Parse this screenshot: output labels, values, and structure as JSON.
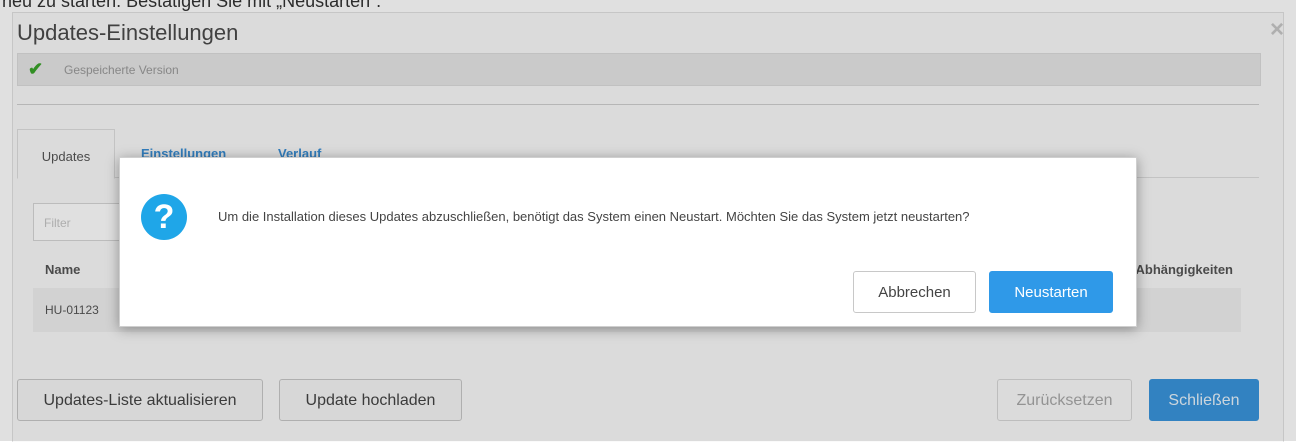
{
  "caption": "neu zu starten. Bestätigen Sie mit „Neustarten“.",
  "window": {
    "title": "Updates-Einstellungen",
    "close_icon": "×",
    "status": {
      "icon": "check-icon",
      "text": "Gespeicherte Version"
    },
    "tabs": [
      {
        "label": "Updates"
      },
      {
        "label": "Einstellungen"
      },
      {
        "label": "Verlauf"
      }
    ],
    "filter_placeholder": "Filter",
    "table": {
      "columns": [
        "Name",
        "Abhängigkeiten"
      ],
      "rows": [
        {
          "name": "HU-01123"
        }
      ]
    },
    "buttons": {
      "refresh": "Updates-Liste aktualisieren",
      "upload": "Update hochladen",
      "reset": "Zurücksetzen",
      "close": "Schließen"
    }
  },
  "dialog": {
    "icon": "question-icon",
    "message": "Um die Installation dieses Updates abzuschließen, benötigt das System einen Neustart. Möchten Sie das System jetzt neustarten?",
    "cancel_label": "Abbrechen",
    "confirm_label": "Neustarten"
  },
  "colors": {
    "primary": "#2f99e8",
    "success": "#3aa329",
    "question_icon": "#1fa6e8"
  }
}
